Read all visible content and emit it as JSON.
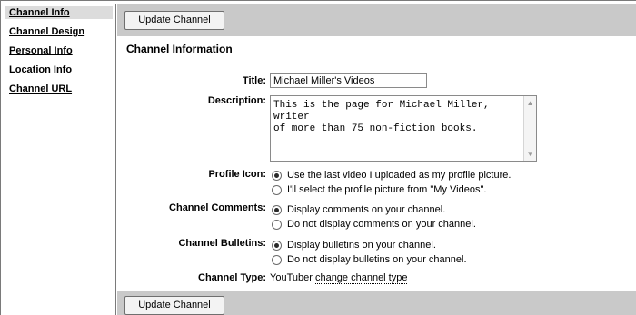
{
  "sidebar": {
    "items": [
      {
        "label": "Channel Info"
      },
      {
        "label": "Channel Design"
      },
      {
        "label": "Personal Info"
      },
      {
        "label": "Location Info"
      },
      {
        "label": "Channel URL"
      }
    ]
  },
  "toolbar": {
    "top_button": "Update Channel",
    "bottom_button": "Update Channel"
  },
  "main": {
    "section_title": "Channel Information",
    "title": {
      "label": "Title:",
      "value": "Michael Miller's Videos"
    },
    "description": {
      "label": "Description:",
      "value": "This is the page for Michael Miller, writer\nof more than 75 non-fiction books."
    },
    "profile_icon": {
      "label": "Profile Icon:",
      "options": [
        {
          "text": "Use the last video I uploaded as my profile picture.",
          "checked": true
        },
        {
          "text": "I'll select the profile picture from \"My Videos\".",
          "checked": false
        }
      ]
    },
    "channel_comments": {
      "label": "Channel Comments:",
      "options": [
        {
          "text": "Display comments on your channel.",
          "checked": true
        },
        {
          "text": "Do not display comments on your channel.",
          "checked": false
        }
      ]
    },
    "channel_bulletins": {
      "label": "Channel Bulletins:",
      "options": [
        {
          "text": "Display bulletins on your channel.",
          "checked": true
        },
        {
          "text": "Do not display bulletins on your channel.",
          "checked": false
        }
      ]
    },
    "channel_type": {
      "label": "Channel Type:",
      "value": "YouTuber",
      "link": "change channel type"
    }
  }
}
